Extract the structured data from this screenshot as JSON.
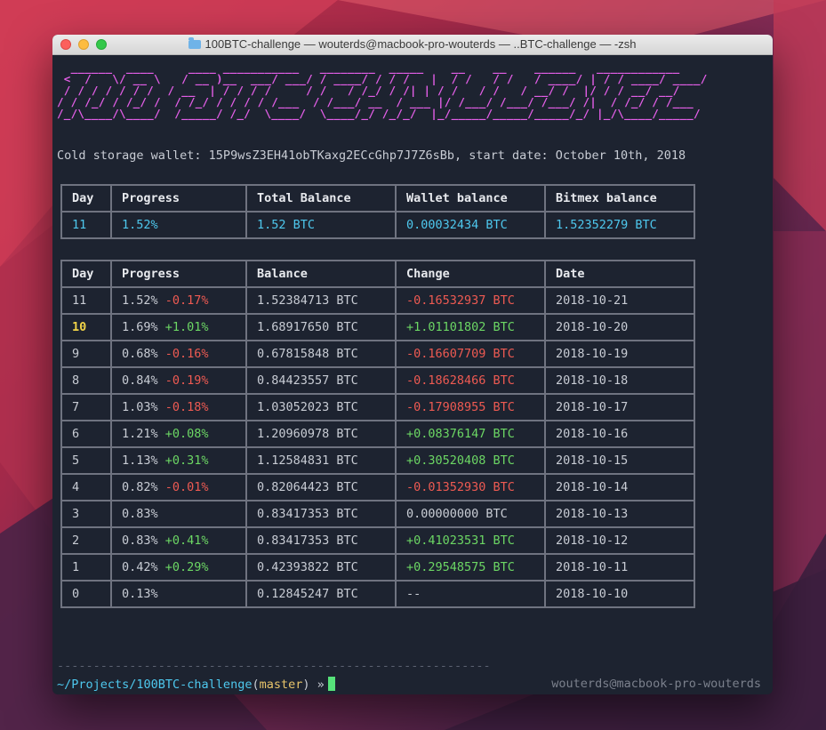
{
  "window": {
    "title": "100BTC-challenge — wouterds@macbook-pro-wouterds — ..BTC-challenge — -zsh",
    "folder_icon": "folder-icon"
  },
  "banner": {
    "text": "  ______  ____     ____ ___________   ________  _____    __    __    ______   ____________\n <  /   \\/ __ \\   / __ )__  ___/ ___/ / ____/ / / /   |  / /   / /   / ____/ | / / ____/ ____/\n / / / / / / /  / __  | / / / /     / /   / /_/ / /| | / /   / /   / __/ /  |/ / / __/ __/\n/ / /_/ / /_/ /  / /_/ / / / / /___  / /___/ __  / ___ |/ /___/ /___/ /___/ /|  / /_/ / /___\n/_/\\____/\\____/  /_____/ /_/  \\____/  \\____/_/ /_/_/  |_/_____/_____/_____/_/ |_/\\____/_____/"
  },
  "wallet_line": "Cold storage wallet: 15P9wsZ3EH41obTKaxg2ECcGhp7J7Z6sBb, start date: October 10th, 2018",
  "summary": {
    "headers": [
      "Day",
      "Progress",
      "Total Balance",
      "Wallet balance",
      "Bitmex balance"
    ],
    "values": [
      "11",
      "1.52%",
      "1.52 BTC",
      "0.00032434 BTC",
      "1.52352279 BTC"
    ]
  },
  "history": {
    "headers": [
      "Day",
      "Progress",
      "Balance",
      "Change",
      "Date"
    ],
    "rows": [
      {
        "day": "11",
        "progress": "1.52%",
        "delta": "-0.17%",
        "delta_color": "red",
        "balance": "1.52384713 BTC",
        "change": "-0.16532937 BTC",
        "change_color": "red",
        "date": "2018-10-21",
        "highlight": false
      },
      {
        "day": "10",
        "progress": "1.69%",
        "delta": "+1.01%",
        "delta_color": "green",
        "balance": "1.68917650 BTC",
        "change": "+1.01101802 BTC",
        "change_color": "green",
        "date": "2018-10-20",
        "highlight": true
      },
      {
        "day": "9",
        "progress": "0.68%",
        "delta": "-0.16%",
        "delta_color": "red",
        "balance": "0.67815848 BTC",
        "change": "-0.16607709 BTC",
        "change_color": "red",
        "date": "2018-10-19",
        "highlight": false
      },
      {
        "day": "8",
        "progress": "0.84%",
        "delta": "-0.19%",
        "delta_color": "red",
        "balance": "0.84423557 BTC",
        "change": "-0.18628466 BTC",
        "change_color": "red",
        "date": "2018-10-18",
        "highlight": false
      },
      {
        "day": "7",
        "progress": "1.03%",
        "delta": "-0.18%",
        "delta_color": "red",
        "balance": "1.03052023 BTC",
        "change": "-0.17908955 BTC",
        "change_color": "red",
        "date": "2018-10-17",
        "highlight": false
      },
      {
        "day": "6",
        "progress": "1.21%",
        "delta": "+0.08%",
        "delta_color": "green",
        "balance": "1.20960978 BTC",
        "change": "+0.08376147 BTC",
        "change_color": "green",
        "date": "2018-10-16",
        "highlight": false
      },
      {
        "day": "5",
        "progress": "1.13%",
        "delta": "+0.31%",
        "delta_color": "green",
        "balance": "1.12584831 BTC",
        "change": "+0.30520408 BTC",
        "change_color": "green",
        "date": "2018-10-15",
        "highlight": false
      },
      {
        "day": "4",
        "progress": "0.82%",
        "delta": "-0.01%",
        "delta_color": "red",
        "balance": "0.82064423 BTC",
        "change": "-0.01352930 BTC",
        "change_color": "red",
        "date": "2018-10-14",
        "highlight": false
      },
      {
        "day": "3",
        "progress": "0.83%",
        "delta": "",
        "delta_color": "",
        "balance": "0.83417353 BTC",
        "change": "0.00000000 BTC",
        "change_color": "plain",
        "date": "2018-10-13",
        "highlight": false
      },
      {
        "day": "2",
        "progress": "0.83%",
        "delta": "+0.41%",
        "delta_color": "green",
        "balance": "0.83417353 BTC",
        "change": "+0.41023531 BTC",
        "change_color": "green",
        "date": "2018-10-12",
        "highlight": false
      },
      {
        "day": "1",
        "progress": "0.42%",
        "delta": "+0.29%",
        "delta_color": "green",
        "balance": "0.42393822 BTC",
        "change": "+0.29548575 BTC",
        "change_color": "green",
        "date": "2018-10-11",
        "highlight": false
      },
      {
        "day": "0",
        "progress": "0.13%",
        "delta": "",
        "delta_color": "",
        "balance": "0.12845247 BTC",
        "change": "--",
        "change_color": "plain",
        "date": "2018-10-10",
        "highlight": false
      }
    ]
  },
  "divider": "------------------------------------------------------------",
  "prompt": {
    "path": "~/Projects/100BTC-challenge",
    "open": "(",
    "branch": "master",
    "close": ")",
    "symbol": "»",
    "right": "wouterds@macbook-pro-wouterds"
  },
  "colors": {
    "red": "#ee5a52",
    "green": "#6cd764",
    "cyan": "#4ec8ee",
    "yellow": "#f0d348",
    "banner": "#e25ee6",
    "terminal_bg": "#1d2330"
  }
}
